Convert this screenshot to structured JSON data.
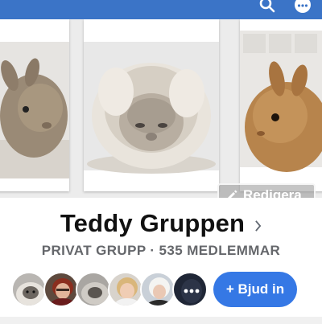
{
  "header": {
    "icons": [
      "search-icon",
      "more-icon"
    ],
    "bar_color": "#3b74c7"
  },
  "cover": {
    "edit_label": "Redigera",
    "photos": [
      "bunny-photo-left",
      "fluffy-bunny-photo",
      "brown-bunny-photo"
    ]
  },
  "group": {
    "name": "Teddy Gruppen",
    "meta": "PRIVAT GRUPP · 535 MEDLEMMAR"
  },
  "members": {
    "avatars": [
      "avatar-bunny",
      "avatar-woman-red",
      "avatar-bunny-2",
      "avatar-woman-blonde",
      "avatar-woman-white-hair",
      "avatar-more"
    ],
    "invite_label": "+ Bjud in",
    "accent_color": "#3578e5"
  }
}
